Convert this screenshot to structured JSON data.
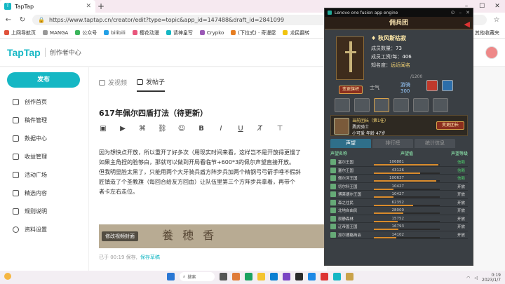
{
  "browser": {
    "tab_title": "TapTap",
    "url": "https://www.taptap.cn/creator/edit?type=topic&app_id=147488&draft_id=2841099",
    "bookmarks": [
      "上网导航页",
      "MANGA",
      "公众号",
      "bilibili",
      "樱花动漫",
      "请神皇写",
      "Crypko",
      "(下拉式) · 奇漫屋",
      "龙民翻转"
    ],
    "bookmarks_right": "其他收藏夹"
  },
  "site": {
    "logo": "TapTap",
    "subtitle": "创作者中心",
    "publish_label": "发布",
    "nav": [
      "创作首页",
      "稿件管理",
      "数据中心",
      "收益管理",
      "活动广场",
      "精选内容",
      "规则说明",
      "资料设置"
    ]
  },
  "editor": {
    "tabs": [
      "发视频",
      "发帖子"
    ],
    "title": "617年佩尔四盾打法（待更新）",
    "paragraphs": [
      "因为想快点开放，所以重开了好多次（用现实时间来看，这样岂不是开放得更慢了",
      "如果主角捏的脸够白，那就可以做到开局看临节+600*3的佩尔声望直接开放。",
      "但我明显脸太黑了，只能用两个大牙骑兵盾方阵步兵加两个精钢弓弓箭手唾不假斜",
      "匠镇造了个圣教旗（每回合给友方回血）让队伍里第三个方阵步兵拿着，再带个",
      "者卡左右走位。"
    ],
    "cover_button": "修改视频封面",
    "save_time": "已于 00:19 保存,",
    "save_link": "保存草稿"
  },
  "emulator": {
    "title": "Lenovo one fusion app engine"
  },
  "game": {
    "title": "佣兵团",
    "name": "秋风斯枯寂",
    "stats": [
      {
        "label": "成员数量：",
        "value": "73"
      },
      {
        "label": "成员工资/每：",
        "value": "406"
      },
      {
        "label": "知名度：",
        "value": "远近闻名"
      }
    ],
    "capacity": "/1200",
    "change_flag": "变更旗帜",
    "morale_label": "士气",
    "troop_label": "游骑",
    "troop_value": "300",
    "leader_line1": "当前团长（第1任）",
    "leader_line2": "勇武骑士",
    "leader_line3": "小可爱  年龄 47岁",
    "change_leader": "变更团长",
    "tabs": [
      "声望",
      "排行榜",
      "统计信息"
    ],
    "headers": [
      "声望名称",
      "声望值",
      "声望等级"
    ],
    "rows": [
      {
        "name": "塞尔王国",
        "value": "106881",
        "level": "信赖",
        "pct": 0.98
      },
      {
        "name": "塞尔王国",
        "value": "43126",
        "level": "信赖",
        "pct": 0.7
      },
      {
        "name": "佩尔河王国",
        "value": "100637",
        "level": "信赖",
        "pct": 0.95
      },
      {
        "name": "切尔科王国",
        "value": "10427",
        "level": "开放",
        "pct": 0.3
      },
      {
        "name": "博莱德尔王国",
        "value": "10427",
        "level": "开放",
        "pct": 0.3
      },
      {
        "name": "森之住民",
        "value": "62352",
        "level": "开放",
        "pct": 0.6
      },
      {
        "name": "北地自由民",
        "value": "28000",
        "level": "开放",
        "pct": 0.45
      },
      {
        "name": "寂静森林",
        "value": "15752",
        "level": "开放",
        "pct": 0.36
      },
      {
        "name": "辽帝国王国",
        "value": "16793",
        "level": "开放",
        "pct": 0.37
      },
      {
        "name": "加尔德格商会",
        "value": "14102",
        "level": "开放",
        "pct": 0.34
      }
    ]
  },
  "taskbar": {
    "search": "搜索",
    "time": "0:19",
    "date": "2023/1/7"
  },
  "colors": {
    "accent": "#15b7c4",
    "game_tab": "#2f6f8a",
    "bar": "#d98b2b"
  }
}
